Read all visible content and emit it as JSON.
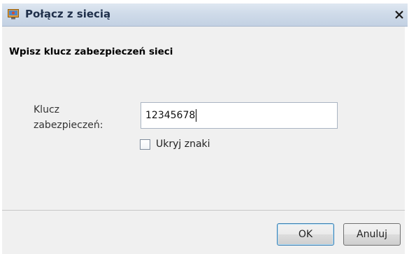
{
  "window": {
    "title": "Połącz z siecią",
    "icons": {
      "app": "network-connect-icon",
      "close": "close-icon"
    }
  },
  "content": {
    "heading": "Wpisz klucz zabezpieczeń sieci",
    "key_label_line1": "Klucz",
    "key_label_line2": "zabezpieczeń:",
    "key_value": "12345678",
    "hide_checkbox_label": "Ukryj znaki",
    "hide_checked": false
  },
  "buttons": {
    "ok": "OK",
    "cancel": "Anuluj"
  }
}
